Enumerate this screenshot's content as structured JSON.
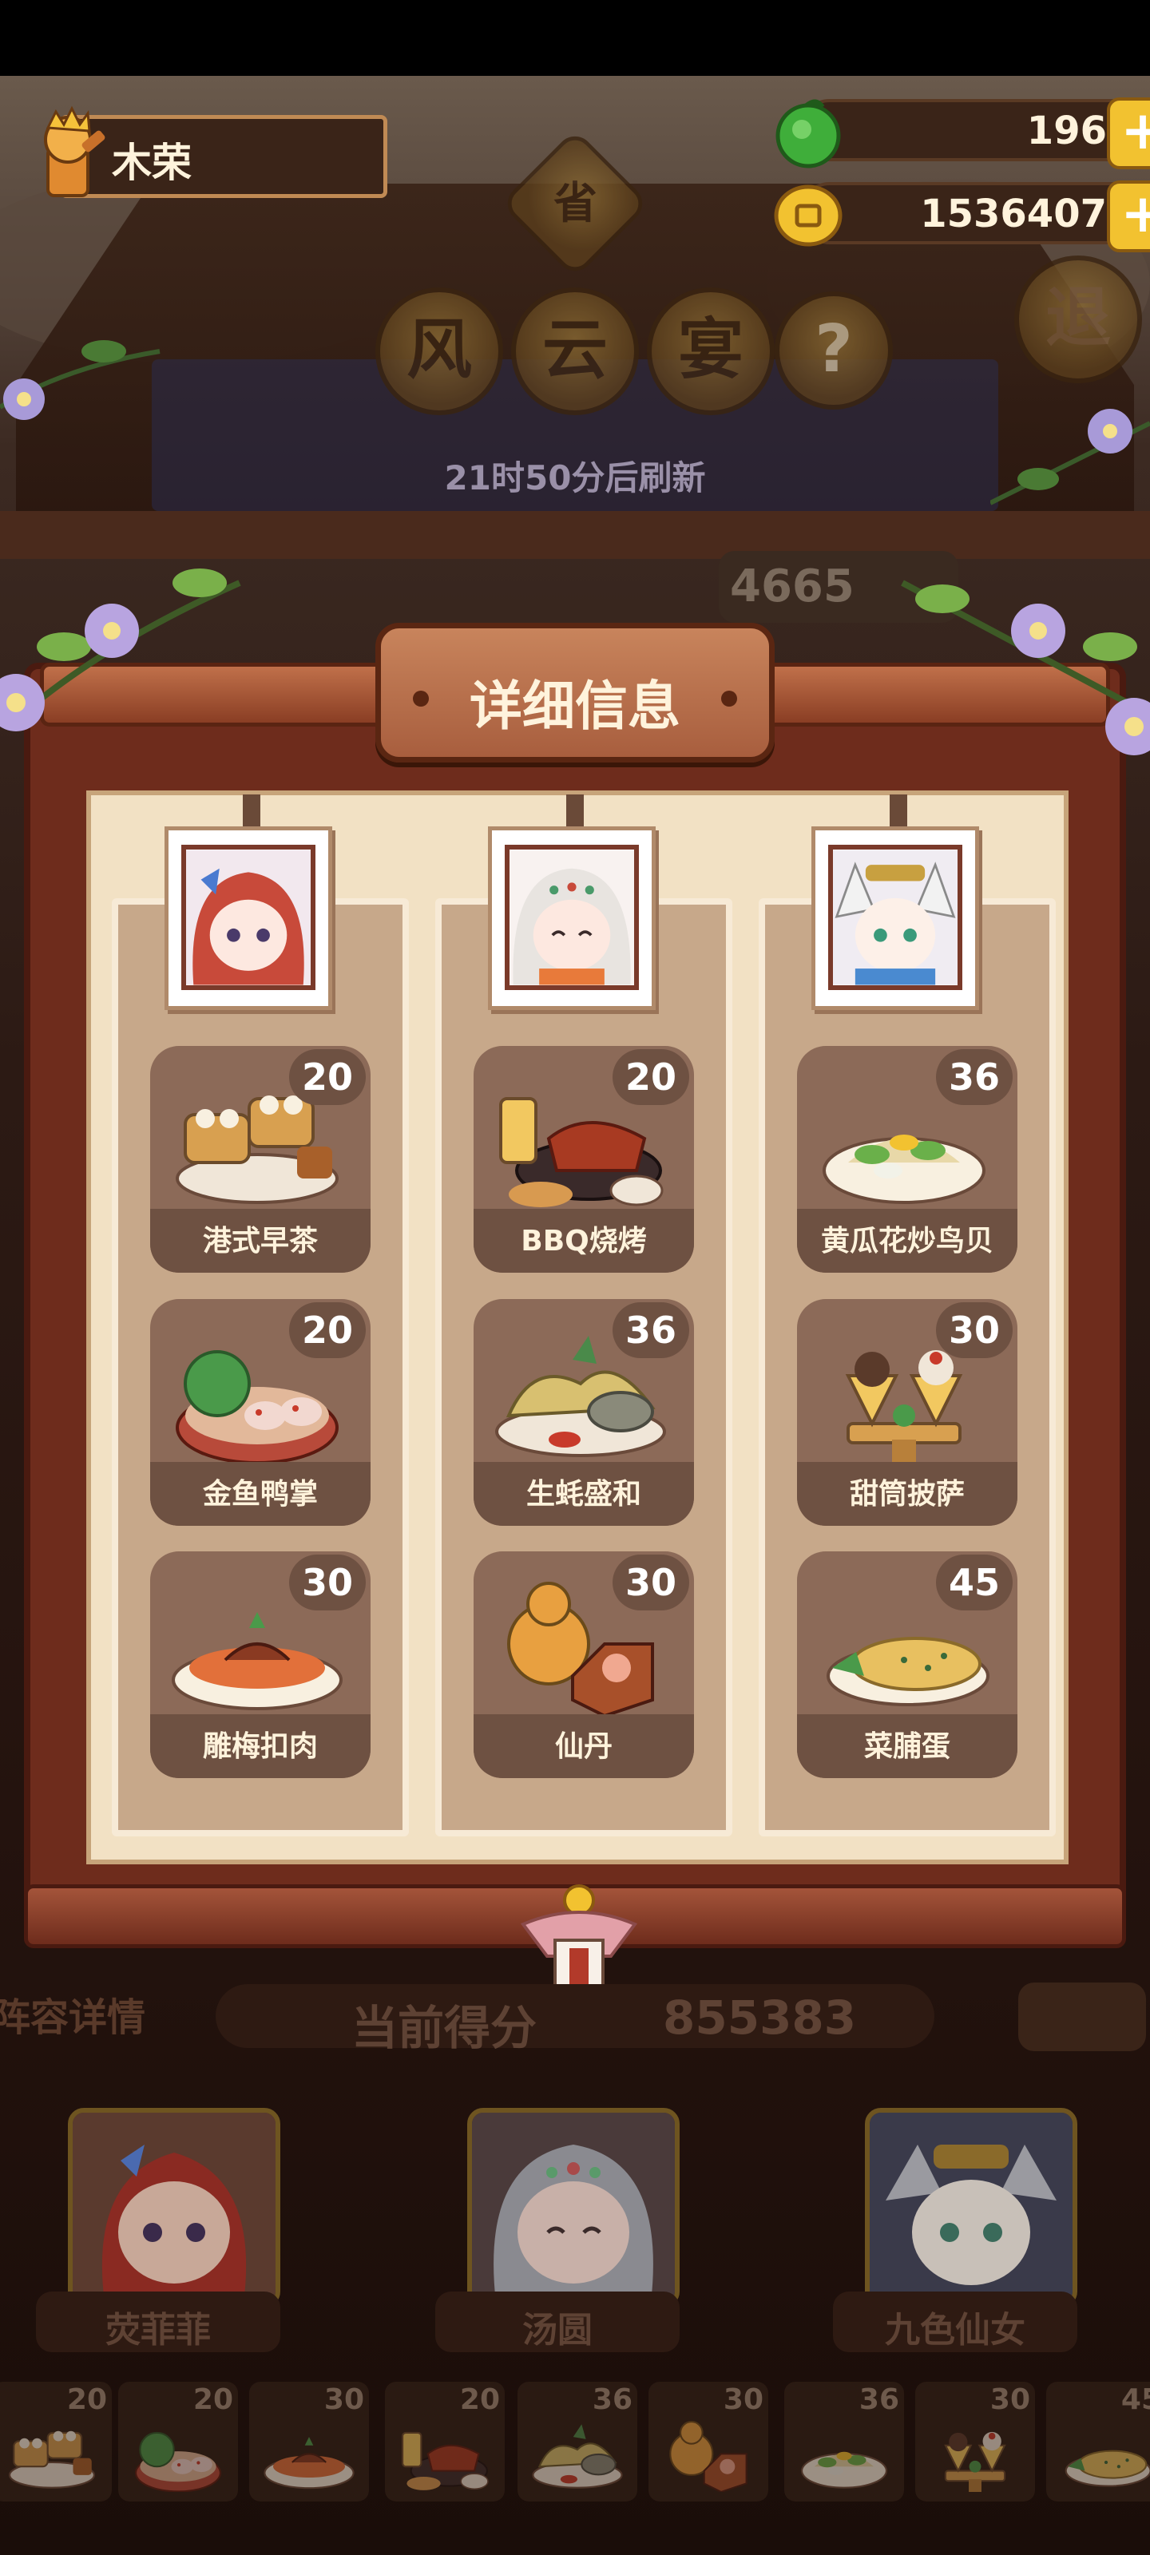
{
  "player": {
    "name": "木荣"
  },
  "currency": {
    "jade": {
      "value": "196",
      "icon": "green-jade-icon"
    },
    "coins": {
      "value": "1536407",
      "icon": "gold-coin-icon"
    },
    "plus_label": "+"
  },
  "header": {
    "province_char": "省",
    "buttons": [
      "风",
      "云",
      "宴",
      "?"
    ],
    "exit_label": "退",
    "refresh_text": "21时50分后刷新",
    "bg_score": "4665"
  },
  "modal": {
    "title": "详细信息",
    "columns": [
      {
        "character": "荧菲菲",
        "dishes": [
          {
            "name": "港式早茶",
            "count": "20"
          },
          {
            "name": "金鱼鸭掌",
            "count": "20"
          },
          {
            "name": "雕梅扣肉",
            "count": "30"
          }
        ]
      },
      {
        "character": "汤圆",
        "dishes": [
          {
            "name": "BBQ烧烤",
            "count": "20"
          },
          {
            "name": "生蚝盛和",
            "count": "36"
          },
          {
            "name": "仙丹",
            "count": "30"
          }
        ]
      },
      {
        "character": "九色仙女",
        "dishes": [
          {
            "name": "黄瓜花炒鸟贝",
            "count": "36"
          },
          {
            "name": "甜筒披萨",
            "count": "30"
          },
          {
            "name": "菜脯蛋",
            "count": "45"
          }
        ]
      }
    ]
  },
  "lineup": {
    "title": "阵容详情",
    "score_label": "当前得分",
    "score_value": "855383",
    "heroes": [
      "荧菲菲",
      "汤圆",
      "九色仙女"
    ],
    "strip_counts": [
      "20",
      "20",
      "30",
      "20",
      "36",
      "30",
      "36",
      "30",
      "45"
    ]
  },
  "colors": {
    "frame": "#6e2c1c",
    "paper": "#f2e1c4",
    "dish_card": "#8c6a58",
    "plus_button": "#f2c230"
  }
}
